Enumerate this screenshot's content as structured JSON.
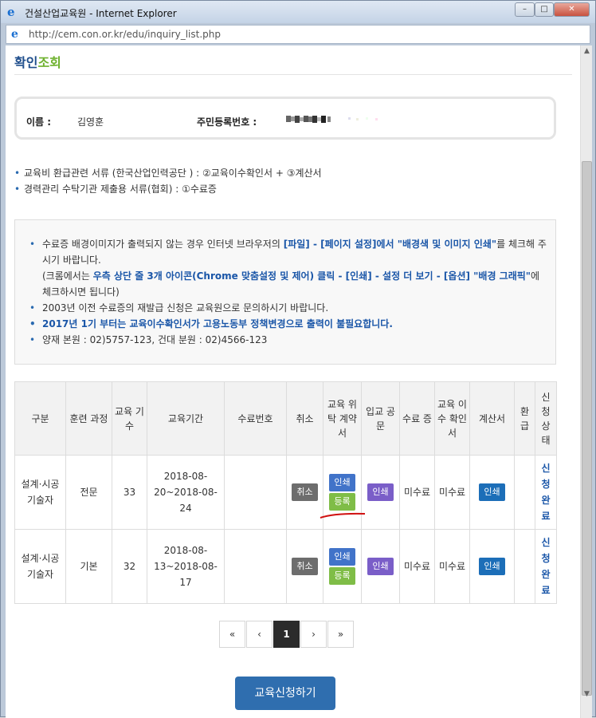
{
  "window": {
    "title": "건설산업교육원 - Internet Explorer",
    "min": "–",
    "max": "□",
    "close": "✕"
  },
  "address": {
    "url": "http://cem.con.or.kr/edu/inquiry_list.php"
  },
  "page": {
    "title_main": "확인",
    "title_accent": "조회"
  },
  "info": {
    "name_label": "이름 :",
    "name_value": "김영훈",
    "id_label": "주민등록번호 :"
  },
  "bullets": [
    "교육비 환급관련 서류 (한국산업인력공단 ) : ②교육이수확인서 + ③계산서",
    "경력관리 수탁기관 제출용 서류(협회) : ①수료증"
  ],
  "notice": {
    "l1_a": "수료증 배경이미지가 출력되지 않는 경우 인터넷 브라우저의 ",
    "l1_b": "[파일] - [페이지 설정]에서 \"배경색 및 이미지 인쇄\"",
    "l1_c": "를 체크해 주시기 바랍니다.",
    "l1_d": "(크롬에서는 ",
    "l1_e": "우측 상단 줄 3개 아이콘(Chrome 맞춤설정 및 제어) 클릭 - [인쇄] - 설정 더 보기 - [옵션] \"배경 그래픽\"",
    "l1_f": "에 체크하시면 됩니다)",
    "l2": "2003년 이전 수료증의 재발급 신청은 교육원으로 문의하시기 바랍니다.",
    "l3": "2017년 1기 부터는 교육이수확인서가 고용노동부 정책변경으로 출력이 불필요합니다.",
    "l4": "양재 본원 : 02)5757-123, 건대 분원 : 02)4566-123"
  },
  "table": {
    "headers": [
      "구분",
      "훈련 과정",
      "교육 기수",
      "교육기간",
      "수료번호",
      "취소",
      "교육 위탁 계약 서",
      "입교 공문",
      "수료 증",
      "교육 이수 확인 서",
      "계산서",
      "환 급",
      "신 청 상 태"
    ],
    "rows": [
      {
        "category": "설계·시공 기술자",
        "course": "전문",
        "term": "33",
        "period": "2018-08-20~2018-08-24",
        "cert_no": "",
        "cancel": "취소",
        "contract_print": "인쇄",
        "contract_register": "등록",
        "official_letter": "인쇄",
        "certificate": "미수료",
        "completion": "미수료",
        "invoice": "인쇄",
        "refund": "",
        "status": "신청완료"
      },
      {
        "category": "설계·시공 기술자",
        "course": "기본",
        "term": "32",
        "period": "2018-08-13~2018-08-17",
        "cert_no": "",
        "cancel": "취소",
        "contract_print": "인쇄",
        "contract_register": "등록",
        "official_letter": "인쇄",
        "certificate": "미수료",
        "completion": "미수료",
        "invoice": "인쇄",
        "refund": "",
        "status": "신청완료"
      }
    ]
  },
  "pagination": {
    "first": "«",
    "prev": "‹",
    "current": "1",
    "next": "›",
    "last": "»"
  },
  "apply_button": "교육신청하기"
}
